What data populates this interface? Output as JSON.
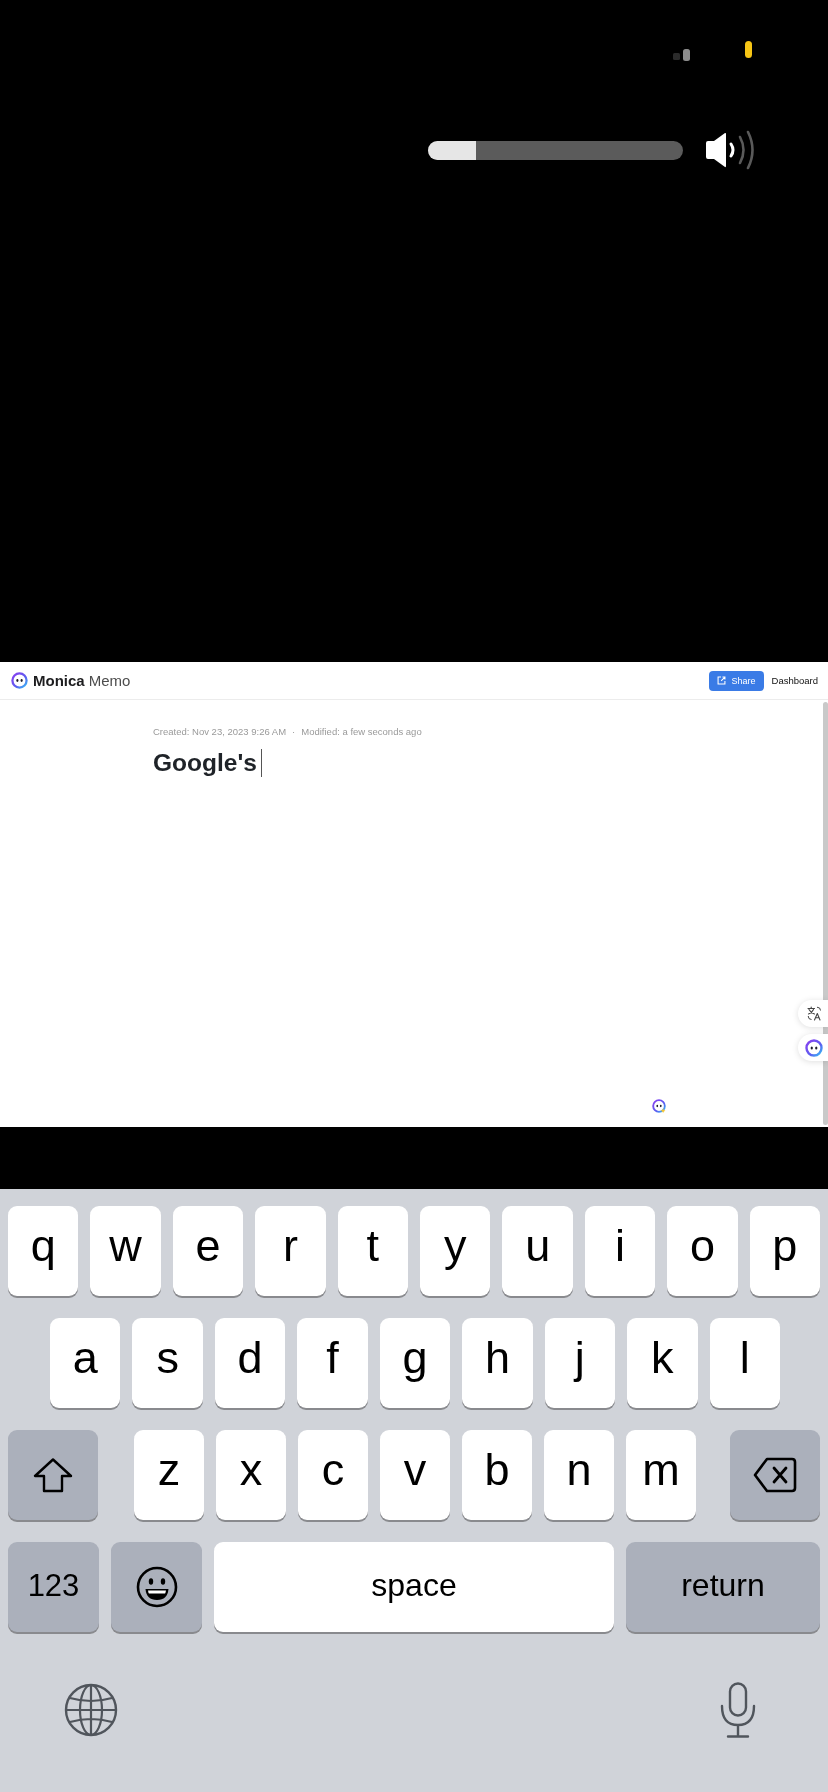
{
  "volume_hud": {
    "level": 0.19
  },
  "header": {
    "brand": "Monica",
    "product": "Memo",
    "share_button": "Share",
    "dashboard_link": "Dashboard"
  },
  "memo": {
    "created": "Created: Nov 23, 2023 9:26 AM",
    "separator": "·",
    "modified": "Modified: a few seconds ago",
    "title": "Google's"
  },
  "keyboard": {
    "rows": [
      {
        "keys": [
          {
            "kind": "letter",
            "label": "q"
          },
          {
            "kind": "letter",
            "label": "w"
          },
          {
            "kind": "letter",
            "label": "e"
          },
          {
            "kind": "letter",
            "label": "r"
          },
          {
            "kind": "letter",
            "label": "t"
          },
          {
            "kind": "letter",
            "label": "y"
          },
          {
            "kind": "letter",
            "label": "u"
          },
          {
            "kind": "letter",
            "label": "i"
          },
          {
            "kind": "letter",
            "label": "o"
          },
          {
            "kind": "letter",
            "label": "p"
          }
        ]
      },
      {
        "keys": [
          {
            "kind": "letter",
            "label": "a"
          },
          {
            "kind": "letter",
            "label": "s"
          },
          {
            "kind": "letter",
            "label": "d"
          },
          {
            "kind": "letter",
            "label": "f"
          },
          {
            "kind": "letter",
            "label": "g"
          },
          {
            "kind": "letter",
            "label": "h"
          },
          {
            "kind": "letter",
            "label": "j"
          },
          {
            "kind": "letter",
            "label": "k"
          },
          {
            "kind": "letter",
            "label": "l"
          }
        ]
      },
      {
        "keys": [
          {
            "kind": "shift"
          },
          {
            "kind": "letter",
            "label": "z"
          },
          {
            "kind": "letter",
            "label": "x"
          },
          {
            "kind": "letter",
            "label": "c"
          },
          {
            "kind": "letter",
            "label": "v"
          },
          {
            "kind": "letter",
            "label": "b"
          },
          {
            "kind": "letter",
            "label": "n"
          },
          {
            "kind": "letter",
            "label": "m"
          },
          {
            "kind": "delete"
          }
        ]
      },
      {
        "keys": [
          {
            "kind": "numbers",
            "label": "123"
          },
          {
            "kind": "emoji"
          },
          {
            "kind": "space",
            "label": "space"
          },
          {
            "kind": "return",
            "label": "return"
          }
        ]
      }
    ]
  }
}
